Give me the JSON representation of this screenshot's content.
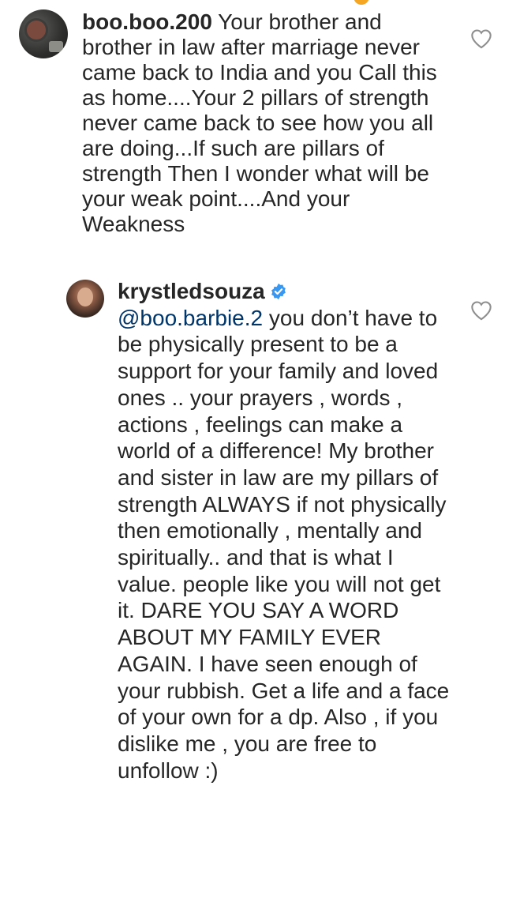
{
  "comments": [
    {
      "username": "boo.boo.200",
      "text": " Your brother and brother in law after marriage never came back to India and you Call this as home....Your 2 pillars of strength never came back to see how you all are doing...If such are pillars of strength Then I wonder what will be your weak point....And your Weakness",
      "avatar_icon": "user-avatar-icon",
      "like_icon": "heart-outline-icon"
    },
    {
      "username": "krystledsouza",
      "verified": true,
      "mention": "@boo.barbie.2",
      "text": " you don’t have to be physically present to be a support for your family and loved ones .. your prayers , words , actions , feelings can make a world of a difference! My brother and sister in law are my pillars of strength ALWAYS if not physically then emotionally , mentally and spiritually.. and that is what I value.  people like you will not get it.  DARE YOU SAY A WORD ABOUT MY FAMILY EVER AGAIN. I have seen enough of your rubbish. Get a life and a face of your own for a dp. Also , if you dislike me , you are free to unfollow :)",
      "avatar_icon": "user-avatar-icon",
      "verified_icon": "verified-badge-icon",
      "like_icon": "heart-outline-icon"
    }
  ],
  "colors": {
    "text": "#262626",
    "mention": "#003569",
    "verified": "#3897f0",
    "heart_stroke": "#8e8e8e"
  }
}
